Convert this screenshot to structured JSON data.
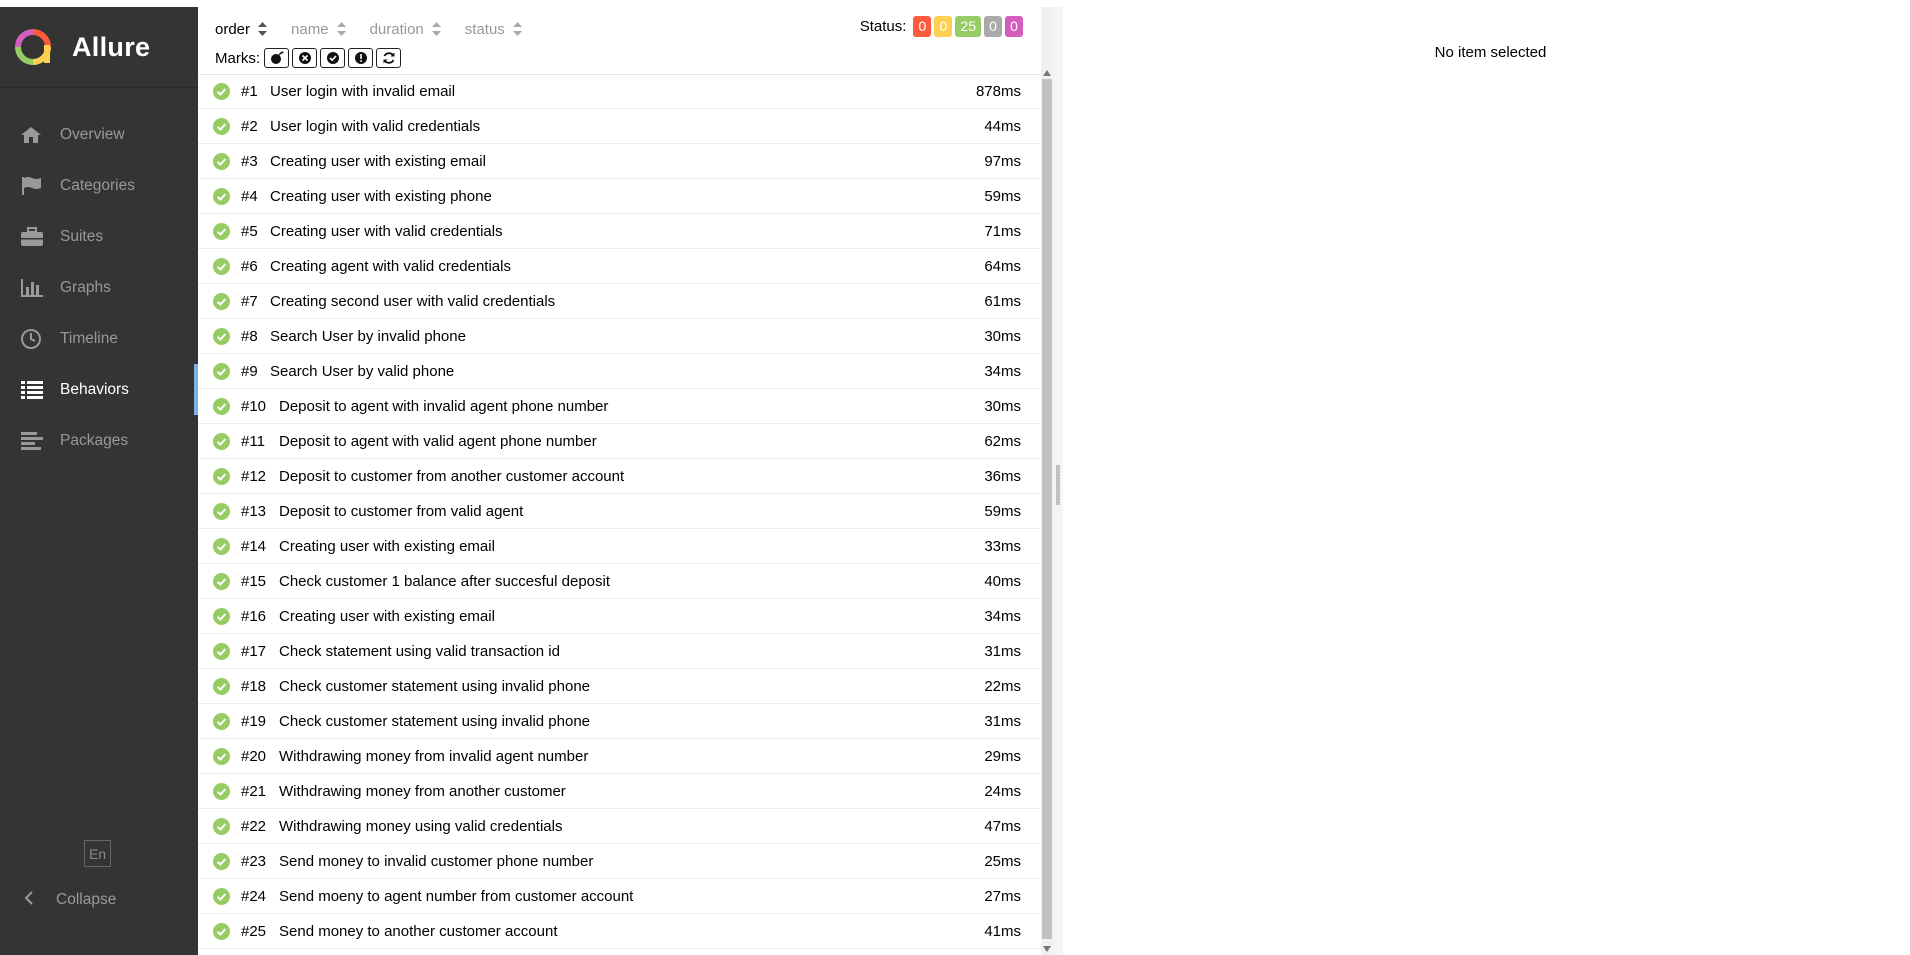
{
  "app": {
    "name": "Allure",
    "colors": {
      "sidebar_bg": "#343434",
      "active_indicator": "#7ab2e6",
      "passed": "#97cc64",
      "failed": "#fd5a3e",
      "broken": "#ffd050",
      "skipped": "#aaaaaa",
      "unknown": "#d35ebe"
    }
  },
  "sidebar": {
    "items": [
      {
        "label": "Overview",
        "icon": "home-icon",
        "active": false
      },
      {
        "label": "Categories",
        "icon": "flag-icon",
        "active": false
      },
      {
        "label": "Suites",
        "icon": "briefcase-icon",
        "active": false
      },
      {
        "label": "Graphs",
        "icon": "bar-chart-icon",
        "active": false
      },
      {
        "label": "Timeline",
        "icon": "clock-icon",
        "active": false
      },
      {
        "label": "Behaviors",
        "icon": "list-icon",
        "active": true
      },
      {
        "label": "Packages",
        "icon": "align-left-icon",
        "active": false
      }
    ],
    "language": "En",
    "collapse_label": "Collapse"
  },
  "tree": {
    "sorters": [
      {
        "label": "order",
        "active": true
      },
      {
        "label": "name",
        "active": false
      },
      {
        "label": "duration",
        "active": false
      },
      {
        "label": "status",
        "active": false
      }
    ],
    "status_label": "Status:",
    "status_counts": {
      "failed": "0",
      "broken": "0",
      "passed": "25",
      "skipped": "0",
      "unknown": "0"
    },
    "marks_label": "Marks:",
    "marks": [
      "flaky-icon",
      "new-failed-icon",
      "new-passed-icon",
      "new-broken-icon",
      "retries-icon"
    ],
    "rows": [
      {
        "num": "#1",
        "name": "User login with invalid email",
        "duration": "878ms",
        "status": "passed"
      },
      {
        "num": "#2",
        "name": "User login with valid credentials",
        "duration": "44ms",
        "status": "passed"
      },
      {
        "num": "#3",
        "name": "Creating user with existing email",
        "duration": "97ms",
        "status": "passed"
      },
      {
        "num": "#4",
        "name": "Creating user with existing phone",
        "duration": "59ms",
        "status": "passed"
      },
      {
        "num": "#5",
        "name": "Creating user with valid credentials",
        "duration": "71ms",
        "status": "passed"
      },
      {
        "num": "#6",
        "name": "Creating agent with valid credentials",
        "duration": "64ms",
        "status": "passed"
      },
      {
        "num": "#7",
        "name": "Creating second user with valid credentials",
        "duration": "61ms",
        "status": "passed"
      },
      {
        "num": "#8",
        "name": "Search User by invalid phone",
        "duration": "30ms",
        "status": "passed"
      },
      {
        "num": "#9",
        "name": "Search User by valid phone",
        "duration": "34ms",
        "status": "passed"
      },
      {
        "num": "#10",
        "name": "Deposit to agent with invalid agent phone number",
        "duration": "30ms",
        "status": "passed"
      },
      {
        "num": "#11",
        "name": "Deposit to agent with valid agent phone number",
        "duration": "62ms",
        "status": "passed"
      },
      {
        "num": "#12",
        "name": "Deposit to customer from another customer account",
        "duration": "36ms",
        "status": "passed"
      },
      {
        "num": "#13",
        "name": "Deposit to customer from valid agent",
        "duration": "59ms",
        "status": "passed"
      },
      {
        "num": "#14",
        "name": "Creating user with existing email",
        "duration": "33ms",
        "status": "passed"
      },
      {
        "num": "#15",
        "name": "Check customer 1 balance after succesful deposit",
        "duration": "40ms",
        "status": "passed"
      },
      {
        "num": "#16",
        "name": "Creating user with existing email",
        "duration": "34ms",
        "status": "passed"
      },
      {
        "num": "#17",
        "name": "Check statement using valid transaction id",
        "duration": "31ms",
        "status": "passed"
      },
      {
        "num": "#18",
        "name": "Check customer statement using invalid phone",
        "duration": "22ms",
        "status": "passed"
      },
      {
        "num": "#19",
        "name": "Check customer statement using invalid phone",
        "duration": "31ms",
        "status": "passed"
      },
      {
        "num": "#20",
        "name": "Withdrawing money from invalid agent number",
        "duration": "29ms",
        "status": "passed"
      },
      {
        "num": "#21",
        "name": "Withdrawing money from another customer",
        "duration": "24ms",
        "status": "passed"
      },
      {
        "num": "#22",
        "name": "Withdrawing money using valid credentials",
        "duration": "47ms",
        "status": "passed"
      },
      {
        "num": "#23",
        "name": "Send money to invalid customer phone number",
        "duration": "25ms",
        "status": "passed"
      },
      {
        "num": "#24",
        "name": "Send moeny to agent number from customer account",
        "duration": "27ms",
        "status": "passed"
      },
      {
        "num": "#25",
        "name": "Send money to another customer account",
        "duration": "41ms",
        "status": "passed"
      }
    ]
  },
  "detail": {
    "empty_message": "No item selected"
  }
}
